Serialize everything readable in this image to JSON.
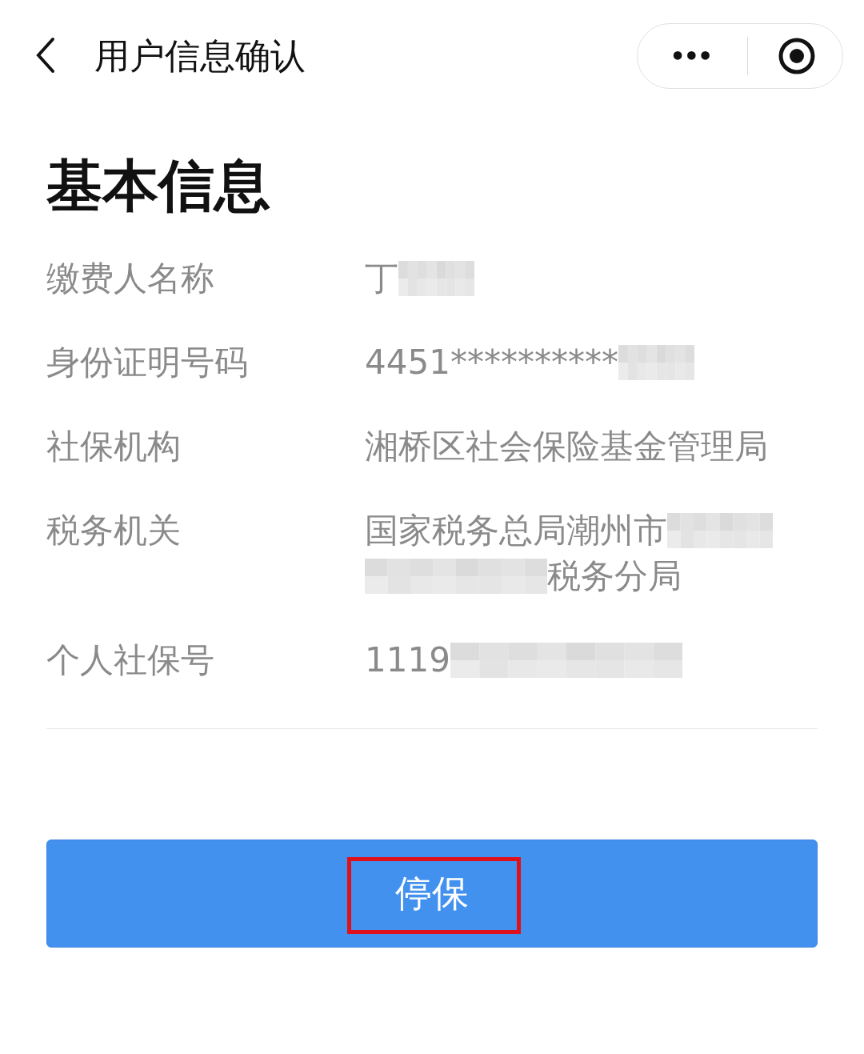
{
  "nav_bar": {
    "title": "用户信息确认",
    "capsule": {
      "more": "•••"
    }
  },
  "section": {
    "title": "基本信息",
    "rows": [
      {
        "label": "缴费人名称",
        "lines": [
          [
            {
              "kind": "text",
              "text": "丁"
            },
            {
              "kind": "blur_short"
            }
          ]
        ]
      },
      {
        "label": "身份证明号码",
        "lines": [
          [
            {
              "kind": "text",
              "text": "4451**********"
            },
            {
              "kind": "blur_short"
            }
          ]
        ]
      },
      {
        "label": "社保机构",
        "lines": [
          [
            {
              "kind": "text",
              "text": "湘桥区社会保险基金管理局"
            }
          ]
        ]
      },
      {
        "label": "税务机关",
        "lines": [
          [
            {
              "kind": "text",
              "text": "国家税务总局潮州市"
            },
            {
              "kind": "blur_medium"
            }
          ],
          [
            {
              "kind": "blur_long"
            },
            {
              "kind": "text",
              "text": "税务分局"
            }
          ]
        ]
      },
      {
        "label": "个人社保号",
        "lines": [
          [
            {
              "kind": "text",
              "text": "1119"
            },
            {
              "kind": "blur_xlong"
            }
          ]
        ]
      }
    ]
  },
  "action_button": {
    "label": "停保",
    "highlighted": true
  }
}
